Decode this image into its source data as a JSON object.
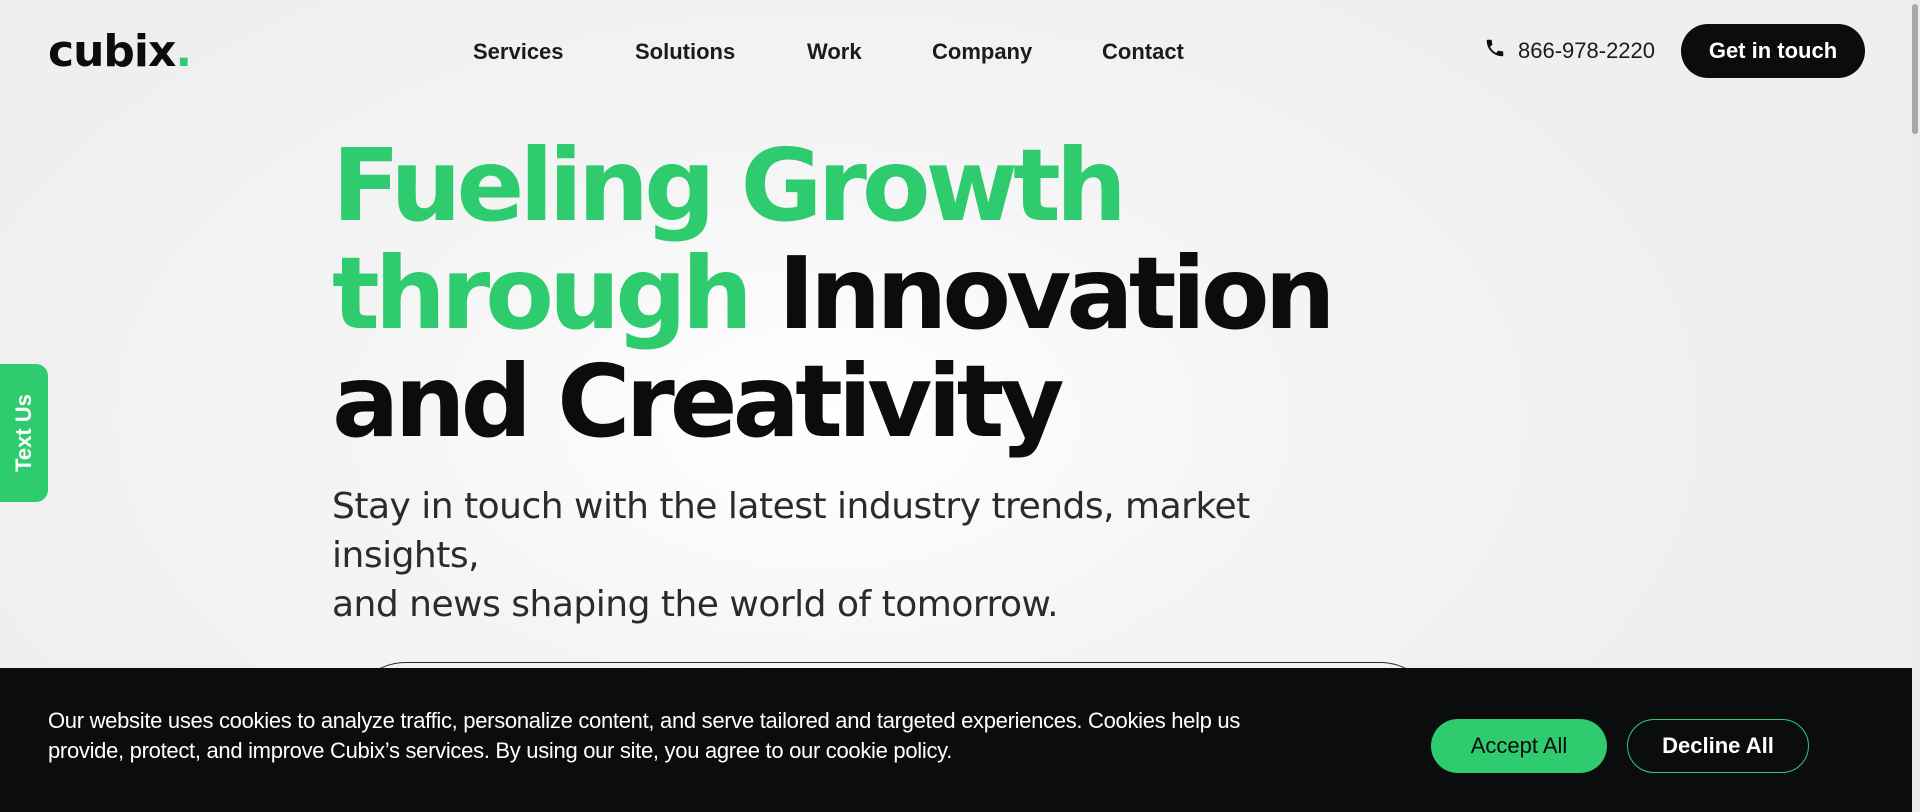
{
  "header": {
    "logo_text": "cubix",
    "logo_dot": ".",
    "nav": [
      "Services",
      "Solutions",
      "Work",
      "Company",
      "Contact"
    ],
    "phone_icon": "phone-icon",
    "phone": "866-978-2220",
    "cta_label": "Get in touch"
  },
  "side_tab": {
    "label": "Text Us"
  },
  "hero": {
    "title_green_1": "Fueling Growth",
    "title_green_2": "through",
    "title_dark_2": "Innovation",
    "title_dark_3": "and Creativity",
    "subtitle_line_1": "Stay in touch with the latest industry trends, market insights,",
    "subtitle_line_2": "and news shaping the world of tomorrow."
  },
  "cookie_banner": {
    "text_line_1": "Our website uses cookies to analyze traffic, personalize content, and serve tailored and targeted experiences. Cookies help us",
    "text_line_2": "provide, protect, and improve Cubix’s services. By using our site, you agree to our cookie policy.",
    "accept_label": "Accept All",
    "decline_label": "Decline All"
  },
  "colors": {
    "accent": "#2ecc6e",
    "dark": "#0b0c0e",
    "background": "#f2f2f2"
  }
}
